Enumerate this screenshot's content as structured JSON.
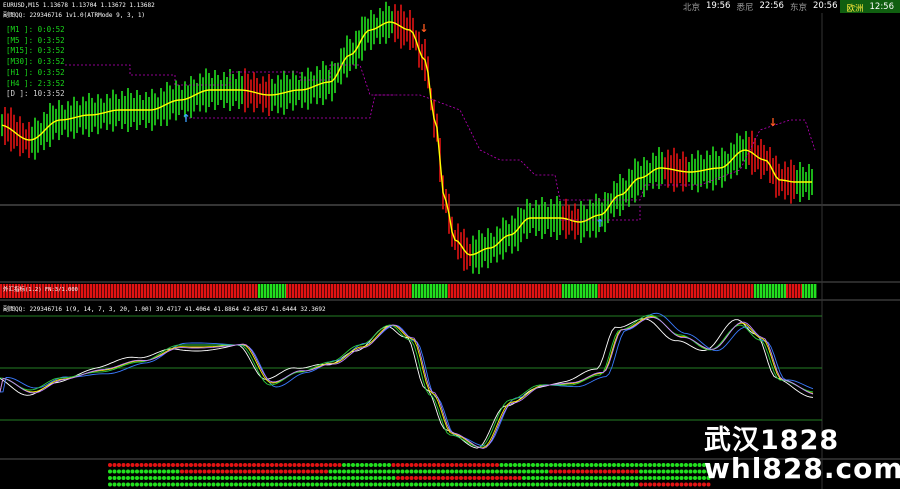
{
  "header": {
    "symbol_line": "EURUSD,M15  1.13678 1.13704 1.13672 1.13682",
    "indicator1": "副图QQ: 229346716 1v1.0(ATRMode 9, 3, 1)",
    "heatmap_label": "外汇指标(1.2) FN:3/1.000",
    "indicator2": "副图QQ: 229346716 1(9, 14, 7, 3, 20, 1.00) 39.4717 41.4064 41.8864 42.4857 41.6444 32.3692"
  },
  "timeframes": [
    "[M1  ]: 0:0:52",
    "[M5  ]: 0:3:52",
    "[M15]: 0:3:52",
    "[M30]: 0:3:52",
    "[H1  ]: 0:3:52",
    "[H4  ]: 2:3:52",
    "[D   ]: 10:3:52"
  ],
  "clock": [
    {
      "city": "北京",
      "time": "19:56",
      "highlight": false
    },
    {
      "city": "悉尼",
      "time": "22:56",
      "highlight": false
    },
    {
      "city": "东京",
      "time": "20:56",
      "highlight": false
    },
    {
      "city": "欧洲",
      "time": "12:56",
      "highlight": true
    }
  ],
  "watermark": {
    "line1": "武汉1828",
    "line2": "whl828.com"
  },
  "colors": {
    "bull": "#22e01f",
    "bear": "#e21313",
    "signal_line": "#ffff00",
    "stop_line": "#c000c0",
    "arrow_up": "#3aa0ff",
    "arrow_down": "#ff5a1f"
  },
  "arrows": [
    {
      "kind": "up",
      "bar": 22
    },
    {
      "kind": "down",
      "bar": 52
    },
    {
      "kind": "up",
      "bar": 73
    },
    {
      "kind": "down",
      "bar": 95
    }
  ]
}
